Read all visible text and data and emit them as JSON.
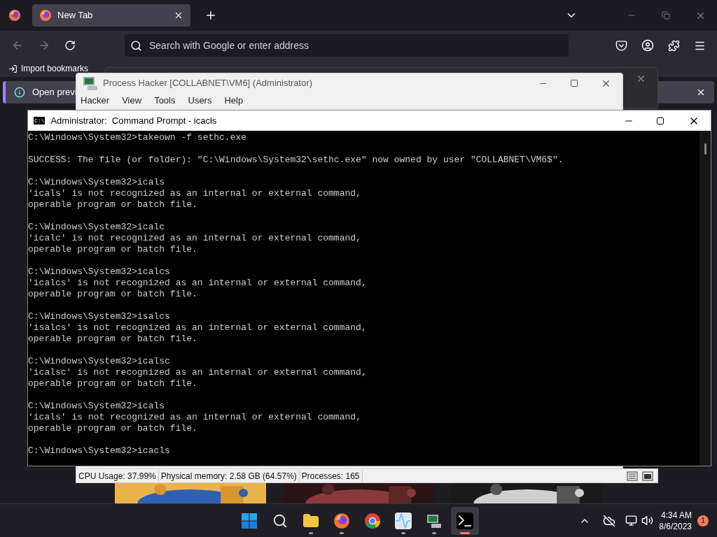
{
  "browser": {
    "tab": {
      "title": "New Tab",
      "selected": true
    },
    "address": {
      "placeholder": "Search with Google or enter address"
    },
    "bookmarks": [
      "Import bookmarks"
    ],
    "notice": "Open previ"
  },
  "process_hacker": {
    "title": "Process Hacker [COLLABNET\\VM6] (Administrator)",
    "menu": [
      "Hacker",
      "View",
      "Tools",
      "Users",
      "Help"
    ],
    "status": [
      "CPU Usage: 37.99%",
      "Physical memory: 2.58 GB (64.57%)",
      "Processes: 165"
    ]
  },
  "console": {
    "title": "Administrator:  Command Prompt - icacls",
    "icon": "C:\\",
    "blocks": [
      [
        "C:\\Windows\\System32>takeown -f sethc.exe"
      ],
      [
        "SUCCESS: The file (or folder): \"C:\\Windows\\System32\\sethc.exe\" now owned by user \"COLLABNET\\VM6$\"."
      ],
      [
        "C:\\Windows\\System32>icals",
        "'icals' is not recognized as an internal or external command,",
        "operable program or batch file."
      ],
      [
        "C:\\Windows\\System32>icalc",
        "'icalc' is not recognized as an internal or external command,",
        "operable program or batch file."
      ],
      [
        "C:\\Windows\\System32>icalcs",
        "'icalcs' is not recognized as an internal or external command,",
        "operable program or batch file."
      ],
      [
        "C:\\Windows\\System32>isalcs",
        "'isalcs' is not recognized as an internal or external command,",
        "operable program or batch file."
      ],
      [
        "C:\\Windows\\System32>icalsc",
        "'icalsc' is not recognized as an internal or external command,",
        "operable program or batch file."
      ],
      [
        "C:\\Windows\\System32>icals",
        "'icals' is not recognized as an internal or external command,",
        "operable program or batch file."
      ],
      [
        "C:\\Windows\\System32>icacls"
      ]
    ]
  },
  "taskbar": {
    "apps": [
      {
        "kind": "start",
        "running": false,
        "selected": false
      },
      {
        "kind": "search",
        "running": false,
        "selected": false
      },
      {
        "kind": "folder",
        "running": true,
        "selected": false
      },
      {
        "kind": "firefox",
        "running": true,
        "selected": false
      },
      {
        "kind": "chrome",
        "running": false,
        "selected": false
      },
      {
        "kind": "monitor",
        "running": true,
        "selected": false
      },
      {
        "kind": "hacker",
        "running": true,
        "selected": false
      },
      {
        "kind": "console",
        "running": true,
        "selected": true
      }
    ],
    "time": "4:34 AM",
    "date": "8/6/2023",
    "badge": "1"
  }
}
